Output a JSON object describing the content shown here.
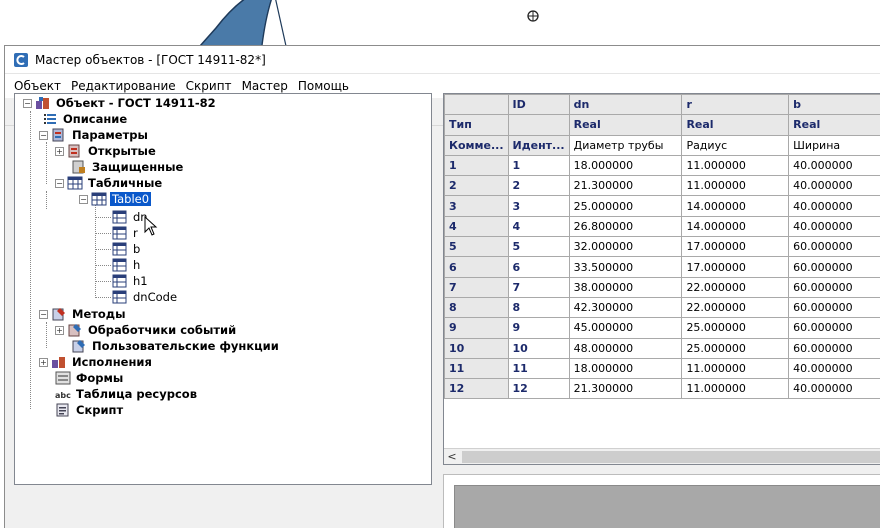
{
  "window": {
    "title": "Мастер объектов - [ГОСТ 14911-82*]"
  },
  "menu": {
    "items": [
      "Объект",
      "Редактирование",
      "Скрипт",
      "Мастер",
      "Помощь"
    ]
  },
  "toolbar": {
    "icons": [
      "new-folder-icon",
      "open-folder-icon",
      "save-icon",
      "undo-icon",
      "redo-icon"
    ]
  },
  "tree": {
    "root": "Объект - ГОСТ 14911-82",
    "description": "Описание",
    "parameters": "Параметры",
    "open": "Открытые",
    "protected": "Защищенные",
    "tabular": "Табличные",
    "table0": "Table0",
    "columns": [
      "dn",
      "r",
      "b",
      "h",
      "h1",
      "dnCode"
    ],
    "methods": "Методы",
    "event_handlers": "Обработчики событий",
    "user_functions": "Пользовательские функции",
    "executions": "Исполнения",
    "forms": "Формы",
    "resource_table": "Таблица ресурсов",
    "script": "Скрипт"
  },
  "grid": {
    "header": [
      "",
      "ID",
      "dn",
      "r",
      "b"
    ],
    "type_row": [
      "Тип",
      "",
      "Real",
      "Real",
      "Real"
    ],
    "comment_row": [
      "Комме...",
      "Идент...",
      "Диаметр трубы",
      "Радиус",
      "Ширина"
    ],
    "rows": [
      [
        "1",
        "1",
        "18.000000",
        "11.000000",
        "40.000000"
      ],
      [
        "2",
        "2",
        "21.300000",
        "11.000000",
        "40.000000"
      ],
      [
        "3",
        "3",
        "25.000000",
        "14.000000",
        "40.000000"
      ],
      [
        "4",
        "4",
        "26.800000",
        "14.000000",
        "40.000000"
      ],
      [
        "5",
        "5",
        "32.000000",
        "17.000000",
        "60.000000"
      ],
      [
        "6",
        "6",
        "33.500000",
        "17.000000",
        "60.000000"
      ],
      [
        "7",
        "7",
        "38.000000",
        "22.000000",
        "60.000000"
      ],
      [
        "8",
        "8",
        "42.300000",
        "22.000000",
        "60.000000"
      ],
      [
        "9",
        "9",
        "45.000000",
        "25.000000",
        "60.000000"
      ],
      [
        "10",
        "10",
        "48.000000",
        "25.000000",
        "60.000000"
      ],
      [
        "11",
        "11",
        "18.000000",
        "11.000000",
        "40.000000"
      ],
      [
        "12",
        "12",
        "21.300000",
        "11.000000",
        "40.000000"
      ]
    ],
    "scroll_left": "<"
  },
  "colors": {
    "selection": "#0a58ca",
    "header_text": "#1c2a6b"
  }
}
